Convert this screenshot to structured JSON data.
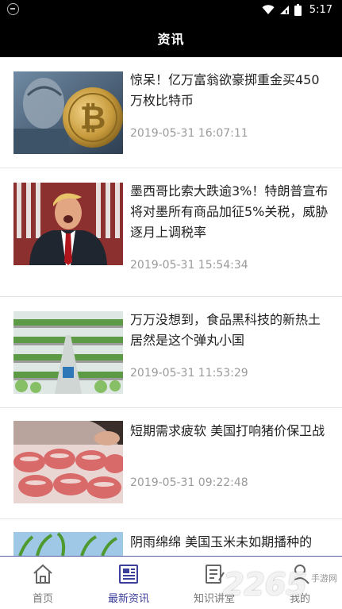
{
  "status_bar": {
    "time": "5:17"
  },
  "header": {
    "title": "资讯"
  },
  "news": [
    {
      "headline": "惊呆！亿万富翁欲豪掷重金买450万枚比特币",
      "date": "2019-05-31 16:07:11",
      "image": "bitcoin-money-image"
    },
    {
      "headline": "墨西哥比索大跌逾3%！特朗普宣布将对墨所有商品加征5%关税，威胁逐月上调税率",
      "date": "2019-05-31 15:54:34",
      "image": "trump-speech-image"
    },
    {
      "headline": "万万没想到，食品黑科技的新热土居然是这个弹丸小国",
      "date": "2019-05-31 11:53:29",
      "image": "vertical-farm-image"
    },
    {
      "headline": "短期需求疲软 美国打响猪价保卫战",
      "date": "2019-05-31 09:22:48",
      "image": "pork-meat-image"
    },
    {
      "headline": "阴雨绵绵 美国玉米未如期播种的",
      "date": "",
      "image": "corn-field-image"
    }
  ],
  "tabs": [
    {
      "label": "首页",
      "icon": "home-icon"
    },
    {
      "label": "最新资讯",
      "icon": "news-icon",
      "active": true
    },
    {
      "label": "知识讲堂",
      "icon": "knowledge-icon"
    },
    {
      "label": "我的",
      "icon": "profile-icon"
    }
  ],
  "watermark": {
    "text": "2265",
    "sub": "手游网"
  }
}
